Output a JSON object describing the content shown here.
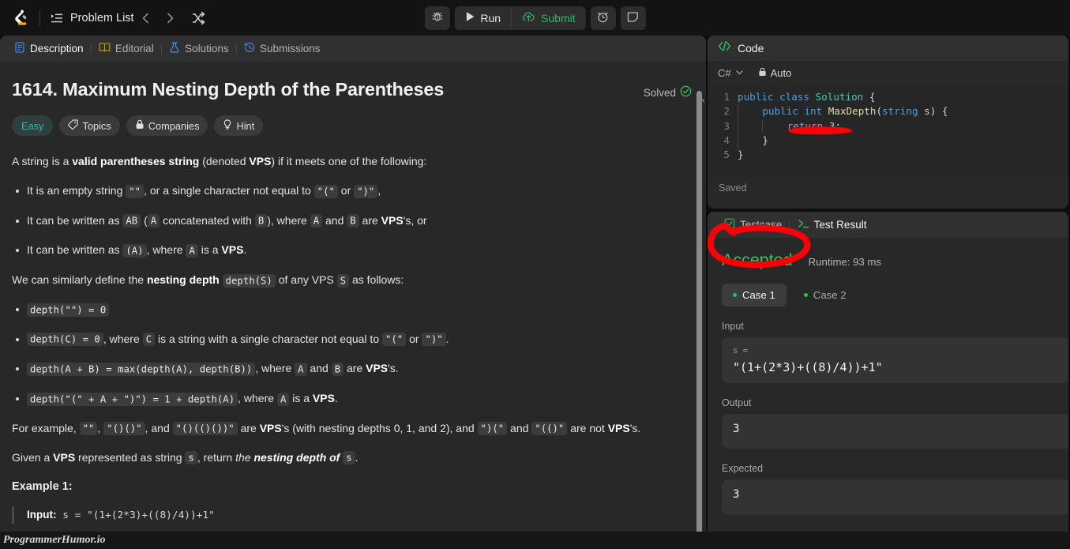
{
  "nav": {
    "logo_icon": "leetcode-logo-icon",
    "problem_list_label": "Problem List",
    "problem_list_icon": "list-icon",
    "prev_icon": "chevron-left-icon",
    "next_icon": "chevron-right-icon",
    "shuffle_icon": "shuffle-icon",
    "debug_icon": "bug-icon",
    "run_label": "Run",
    "run_icon": "play-icon",
    "submit_label": "Submit",
    "submit_icon": "cloud-upload-icon",
    "timer_icon": "timer-icon",
    "note_icon": "note-icon"
  },
  "left": {
    "tabs": [
      {
        "label": "Description",
        "icon": "description-icon",
        "active": true
      },
      {
        "label": "Editorial",
        "icon": "book-icon",
        "active": false
      },
      {
        "label": "Solutions",
        "icon": "flask-icon",
        "active": false
      },
      {
        "label": "Submissions",
        "icon": "history-clock-icon",
        "active": false
      }
    ],
    "title": "1614. Maximum Nesting Depth of the Parentheses",
    "solved_label": "Solved",
    "solved_icon": "check-circle-icon",
    "badges": [
      {
        "label": "Easy",
        "icon": ""
      },
      {
        "label": "Topics",
        "icon": "tag-icon"
      },
      {
        "label": "Companies",
        "icon": "lock-icon"
      },
      {
        "label": "Hint",
        "icon": "lightbulb-icon"
      }
    ],
    "intro": "A string is a valid parentheses string (denoted VPS) if it meets one of the following:",
    "rules": [
      "It is an empty string \"\", or a single character not equal to \"(\" or \")\",",
      "It can be written as AB (A concatenated with B), where A and B are VPS's, or",
      "It can be written as (A), where A is a VPS."
    ],
    "depth_intro": "We can similarly define the nesting depth depth(S) of any VPS S as follows:",
    "depth_rules": [
      "depth(\"\") = 0",
      "depth(C) = 0, where C is a string with a single character not equal to \"(\" or \")\".",
      "depth(A + B) = max(depth(A), depth(B)), where A and B are VPS's.",
      "depth(\"(\" + A + \")\") = 1 + depth(A), where A is a VPS."
    ],
    "example_para": "For example, \"\", \"()()\", and \"()(()())\" are VPS's (with nesting depths 0, 1, and 2), and \")(\" and \"(()\" are not VPS's.",
    "given_para": "Given a VPS represented as string s, return the nesting depth of s.",
    "example_title": "Example 1:",
    "example_input_label": "Input:",
    "example_input_value": "s = \"(1+(2*3)+((8)/4))+1\""
  },
  "code": {
    "header_label": "Code",
    "header_icon": "code-brackets-icon",
    "language": "C#",
    "language_chevron_icon": "chevron-down-icon",
    "auto_label": "Auto",
    "auto_icon": "lock-icon",
    "saved_label": "Saved",
    "lines": [
      {
        "n": "1",
        "text": "public class Solution {"
      },
      {
        "n": "2",
        "text": "    public int MaxDepth(string s) {"
      },
      {
        "n": "3",
        "text": "        return 3;"
      },
      {
        "n": "4",
        "text": "    }"
      },
      {
        "n": "5",
        "text": "}"
      }
    ]
  },
  "result": {
    "tabs": [
      {
        "label": "Testcase",
        "icon": "checkbox-icon",
        "active": false
      },
      {
        "label": "Test Result",
        "icon": "terminal-icon",
        "active": true
      }
    ],
    "status": "Accepted",
    "runtime": "Runtime: 93 ms",
    "cases": [
      {
        "label": "Case 1",
        "active": true
      },
      {
        "label": "Case 2",
        "active": false
      }
    ],
    "input_label": "Input",
    "input_key": "s =",
    "input_value": "\"(1+(2*3)+((8)/4))+1\"",
    "output_label": "Output",
    "output_value": "3",
    "expected_label": "Expected",
    "expected_value": "3"
  },
  "watermark": {
    "text": "ProgrammerHumor.io"
  },
  "colors": {
    "accent_orange": "#ffa116",
    "easy_teal": "#25c2a0",
    "success_green": "#2cbb5d",
    "accepted_green": "#34c759",
    "annotation_red": "#fb0007"
  }
}
